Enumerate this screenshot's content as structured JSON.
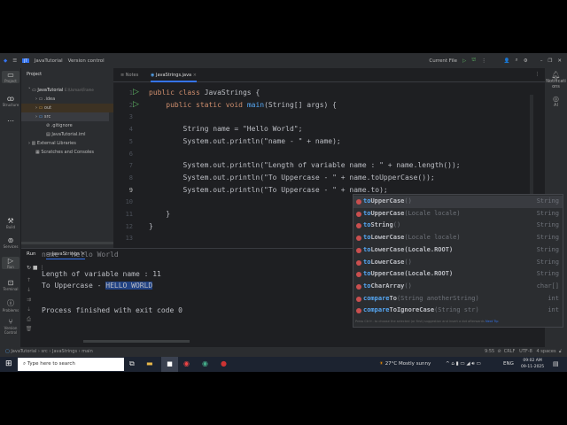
{
  "titlebar": {
    "project": "JavaTutorial",
    "vcs": "Version control",
    "run_config": "Current File"
  },
  "left_tools": [
    "Project",
    "Structure",
    "Build",
    "Services",
    "Run",
    "Terminal",
    "Problems",
    "Version Control"
  ],
  "project_panel": {
    "title": "Project",
    "items": [
      {
        "label": "JavaTutorial",
        "extra": "E:\\Usman\\Frame",
        "depth": 0
      },
      {
        "label": ".idea",
        "depth": 1
      },
      {
        "label": "out",
        "depth": 1
      },
      {
        "label": "src",
        "depth": 1
      },
      {
        "label": ".gitignore",
        "depth": 1
      },
      {
        "label": "JavaTutorial.iml",
        "depth": 1
      },
      {
        "label": "External Libraries",
        "depth": 0
      },
      {
        "label": "Scratches and Consoles",
        "depth": 0
      }
    ]
  },
  "editor": {
    "tabs": [
      {
        "label": "Notes"
      },
      {
        "label": "JavaStrings.java",
        "active": true
      }
    ],
    "lines": [
      "public class JavaStrings {",
      "    public static void main(String[] args) {",
      "",
      "        String name = \"Hello World\";",
      "        System.out.println(\"name - \" + name);",
      "",
      "        System.out.println(\"Length of variable name : \" + name.length());",
      "        System.out.println(\"To Uppercase - \" + name.toUpperCase());",
      "        System.out.println(\"To Uppercase - \" + name.to);",
      "",
      "    }",
      "}",
      ""
    ]
  },
  "completion": {
    "items": [
      {
        "m": "to",
        "n": "UpperCase",
        "a": "()",
        "t": "String"
      },
      {
        "m": "to",
        "n": "UpperCase",
        "a": "(Locale locale)",
        "t": "String"
      },
      {
        "m": "to",
        "n": "String",
        "a": "()",
        "t": "String"
      },
      {
        "m": "to",
        "n": "LowerCase",
        "a": "(Locale locale)",
        "t": "String"
      },
      {
        "m": "to",
        "n": "LowerCase(Locale.ROOT)",
        "a": "",
        "t": "String"
      },
      {
        "m": "to",
        "n": "LowerCase",
        "a": "()",
        "t": "String"
      },
      {
        "m": "to",
        "n": "UpperCase(Locale.ROOT)",
        "a": "",
        "t": "String"
      },
      {
        "m": "to",
        "n": "CharArray",
        "a": "()",
        "t": "char[]"
      },
      {
        "m": "compare",
        "n": "To",
        "a": "(String anotherString)",
        "t": "int"
      },
      {
        "m": "compare",
        "n": "ToIgnoreCase",
        "a": "(String str)",
        "t": "int"
      }
    ],
    "hint": "Press Ctrl+. to choose the selected (or first) suggestion and insert a dot afterwards",
    "next_tip": "Next Tip"
  },
  "right_tools": [
    "Notifications",
    "AI"
  ],
  "run": {
    "label": "Run",
    "tab": "JavaStrings",
    "output": [
      "name - Hello World",
      "Length of variable name : 11",
      "To Uppercase - ",
      "",
      "Process finished with exit code 0"
    ],
    "highlight": "HELLO WORLD"
  },
  "statusbar": {
    "breadcrumb": [
      "JavaTutorial",
      "src",
      "JavaStrings",
      "main"
    ],
    "position": "9:55",
    "line_sep": "CRLF",
    "encoding": "UTF-8",
    "indent": "4 spaces"
  },
  "taskbar": {
    "search_placeholder": "Type here to search",
    "weather": "27°C  Mostly sunny",
    "lang": "ENG",
    "time": "09:02 AM",
    "date": "09-11-2025"
  }
}
